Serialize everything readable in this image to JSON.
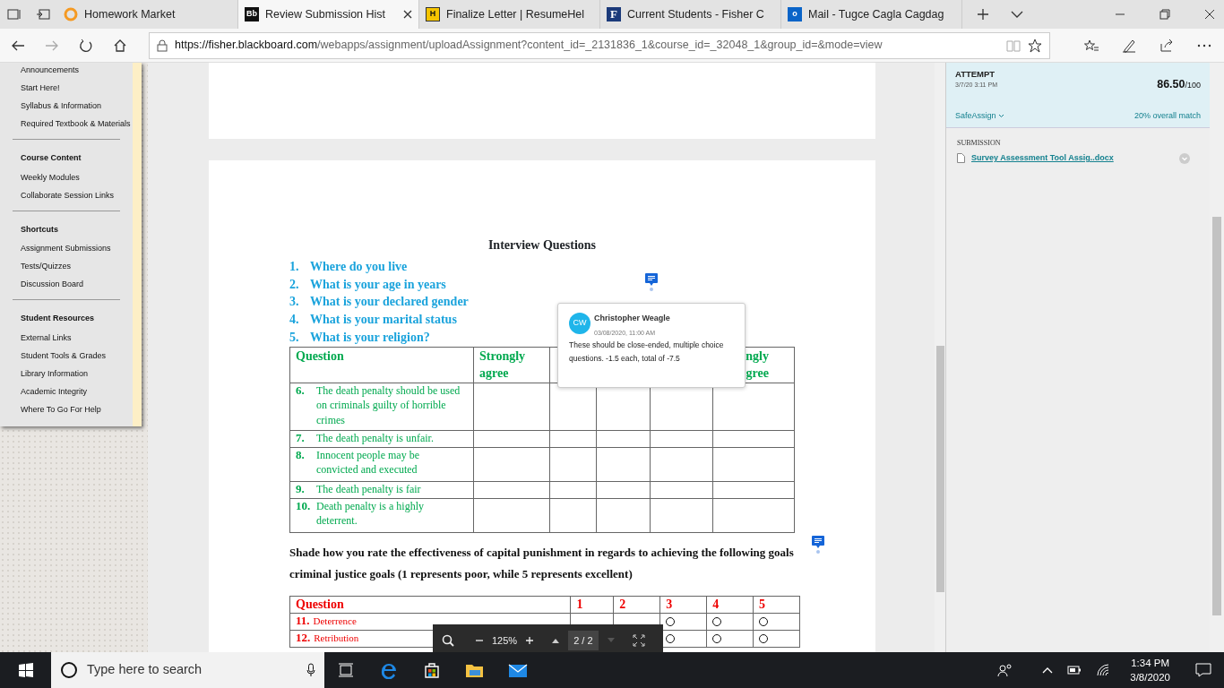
{
  "browser": {
    "tabs": [
      {
        "title": "Homework Market",
        "selected": false,
        "kind": "ring"
      },
      {
        "title": "Review Submission Hist",
        "selected": true,
        "kind": "bb",
        "logo_text": "Bb"
      },
      {
        "title": "Finalize Letter | ResumeHel",
        "selected": false,
        "kind": "h",
        "logo_text": "H"
      },
      {
        "title": "Current Students - Fisher C",
        "selected": false,
        "kind": "f",
        "logo_text": "F"
      },
      {
        "title": "Mail - Tugce Cagla Cagdag",
        "selected": false,
        "kind": "mail",
        "logo_text": "o"
      }
    ],
    "url_host": "https://fisher.blackboard.com",
    "url_path": "/webapps/assignment/uploadAssignment?content_id=_2131836_1&course_id=_32048_1&group_id=&mode=view"
  },
  "sidebar": {
    "sections": [
      {
        "items": [
          "Announcements",
          "Start Here!",
          "Syllabus & Information",
          "Required Textbook & Materials"
        ]
      },
      {
        "heading": "Course Content",
        "items": [
          "Weekly Modules",
          "Collaborate Session Links"
        ]
      },
      {
        "heading": "Shortcuts",
        "items": [
          "Assignment Submissions",
          "Tests/Quizzes",
          "Discussion Board"
        ]
      },
      {
        "heading": "Student Resources",
        "items": [
          "External Links",
          "Student Tools & Grades",
          "Library Information",
          "Academic Integrity",
          "Where To Go For Help"
        ]
      }
    ]
  },
  "document": {
    "title": "Interview Questions",
    "questions": [
      {
        "num": "1.",
        "text": "Where do you live"
      },
      {
        "num": "2.",
        "text": "What is your age in years"
      },
      {
        "num": "3.",
        "text": "What is your declared gender"
      },
      {
        "num": "4.",
        "text": "What is your marital status"
      },
      {
        "num": "5.",
        "text": "What is your religion?"
      }
    ],
    "table1": {
      "columns": [
        "Question",
        "Strongly agree",
        "",
        "",
        "",
        "ngly\ngree"
      ],
      "rows": [
        {
          "num": "6.",
          "text": "The death penalty should be used on criminals guilty of horrible crimes"
        },
        {
          "num": "7.",
          "text": "The death penalty is unfair."
        },
        {
          "num": "8.",
          "text": "Innocent people may be convicted and executed"
        },
        {
          "num": "9.",
          "text": "The death penalty is fair"
        },
        {
          "num": "10.",
          "text": "Death penalty is a highly deterrent."
        }
      ]
    },
    "instruction": "Shade how you rate the effectiveness of capital punishment in regards to achieving the following goals criminal justice goals (1 represents poor, while 5 represents excellent)",
    "table2": {
      "columns": [
        "Question",
        "1",
        "2",
        "3",
        "4",
        "5"
      ],
      "rows": [
        {
          "num": "11.",
          "text": "Deterrence"
        },
        {
          "num": "12.",
          "text": "Retribution"
        }
      ]
    }
  },
  "comment": {
    "initials": "CW",
    "author": "Christopher Weagle",
    "date": "03/08/2020, 11:00 AM",
    "text": "These should be close-ended, multiple choice questions. -1.5 each, total of -7.5"
  },
  "pdf_toolbar": {
    "zoom": "125%",
    "page": "2 / 2"
  },
  "attempt": {
    "label": "ATTEMPT",
    "date": "3/7/20 3:11 PM",
    "score": "86.50",
    "out_of": "/100",
    "safeassign": "SafeAssign",
    "match": "20% overall match"
  },
  "submission": {
    "label": "SUBMISSION",
    "file": "Survey Assessment Tool Assig..docx"
  },
  "taskbar": {
    "search_placeholder": "Type here to search",
    "time": "1:34 PM",
    "date": "3/8/2020"
  }
}
